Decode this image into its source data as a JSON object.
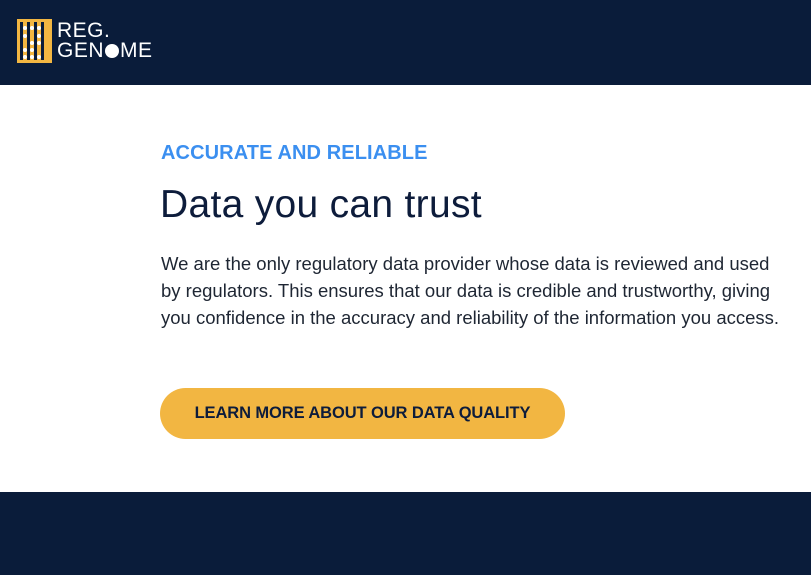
{
  "header": {
    "logo": {
      "line1": "REG.",
      "line2_start": "GEN",
      "line2_end": "ME",
      "accent_color": "#f2b642"
    }
  },
  "main": {
    "eyebrow": "ACCURATE AND RELIABLE",
    "title": "Data you can trust",
    "body": "We are the only regulatory data provider whose data is reviewed and used by regulators. This ensures that our data is credible and trustworthy, giving you confidence in the accuracy and reliability of the information you access.",
    "cta_label": "LEARN MORE ABOUT OUR DATA QUALITY"
  },
  "colors": {
    "navy": "#0a1c3a",
    "eyebrow_blue": "#3b8ff0",
    "button_yellow": "#f2b642"
  }
}
